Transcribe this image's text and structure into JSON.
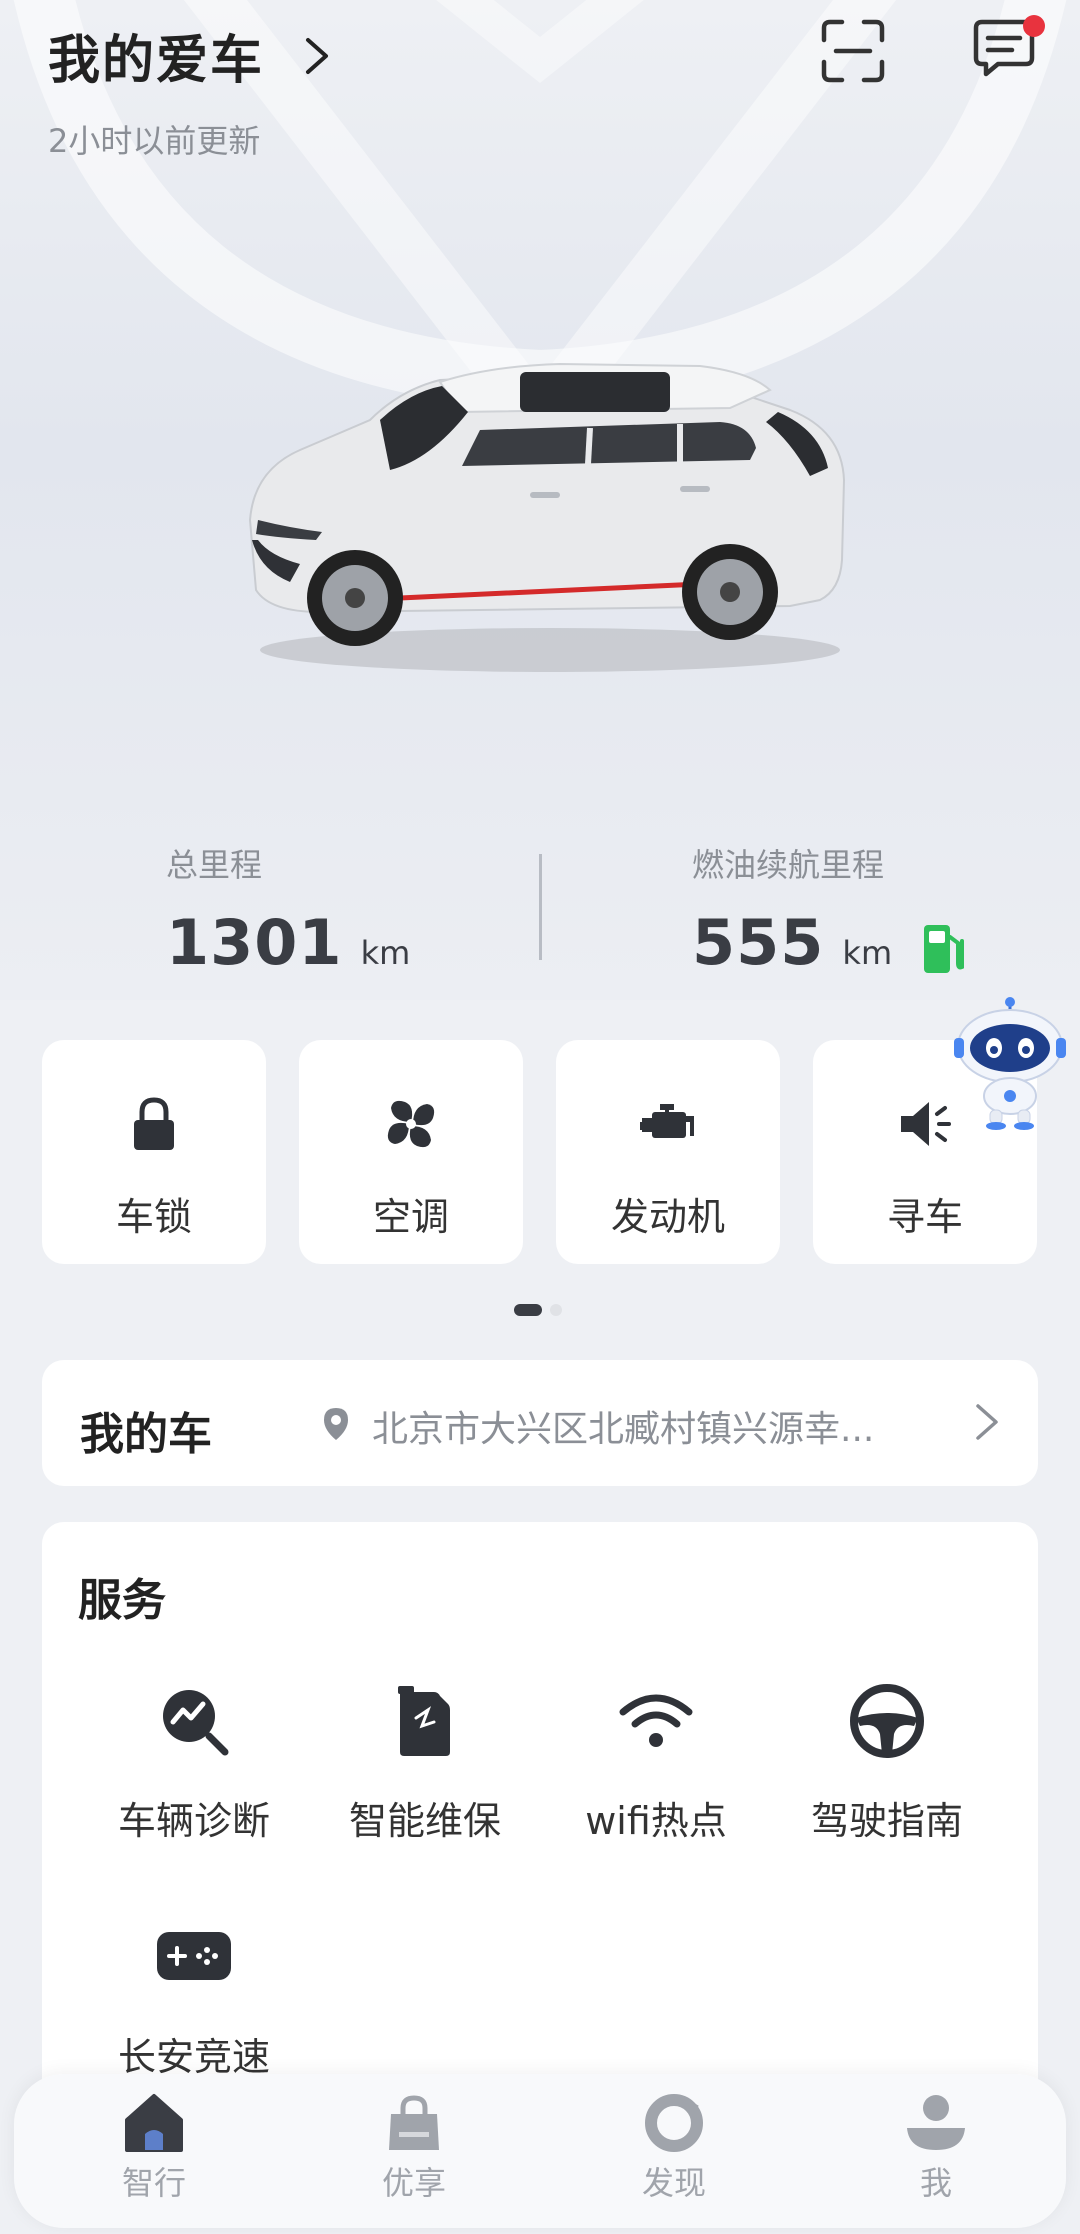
{
  "header": {
    "title": "我的爱车",
    "updated": "2小时以前更新",
    "has_unread_message": true
  },
  "stats": {
    "total": {
      "label": "总里程",
      "value": "1301",
      "unit": "km"
    },
    "range": {
      "label": "燃油续航里程",
      "value": "555",
      "unit": "km"
    }
  },
  "quick_controls": [
    {
      "label": "车锁",
      "icon": "lock-icon"
    },
    {
      "label": "空调",
      "icon": "fan-icon"
    },
    {
      "label": "发动机",
      "icon": "engine-icon"
    },
    {
      "label": "寻车",
      "icon": "horn-icon"
    }
  ],
  "pager": {
    "pages": 2,
    "current": 1
  },
  "my_car": {
    "title": "我的车",
    "address": "北京市大兴区北臧村镇兴源幸..."
  },
  "services": {
    "title": "服务",
    "items": [
      {
        "label": "车辆诊断",
        "icon": "diagnosis-icon"
      },
      {
        "label": "智能维保",
        "icon": "maintenance-icon"
      },
      {
        "label": "wifi热点",
        "icon": "wifi-icon"
      },
      {
        "label": "驾驶指南",
        "icon": "steering-wheel-icon"
      },
      {
        "label": "长安竞速",
        "icon": "gamepad-icon"
      }
    ]
  },
  "bottom_nav": [
    {
      "label": "智行",
      "icon": "home-icon",
      "active": true
    },
    {
      "label": "优享",
      "icon": "shopping-bag-icon",
      "active": false
    },
    {
      "label": "发现",
      "icon": "discover-icon",
      "active": false
    },
    {
      "label": "我",
      "icon": "profile-icon",
      "active": false
    }
  ],
  "colors": {
    "accent_dark": "#3a3d44",
    "notification_dot": "#e8333e",
    "fuel_green": "#2fbf5a",
    "muted_text": "#8b8f96",
    "car_trim_red": "#d42a2a"
  }
}
